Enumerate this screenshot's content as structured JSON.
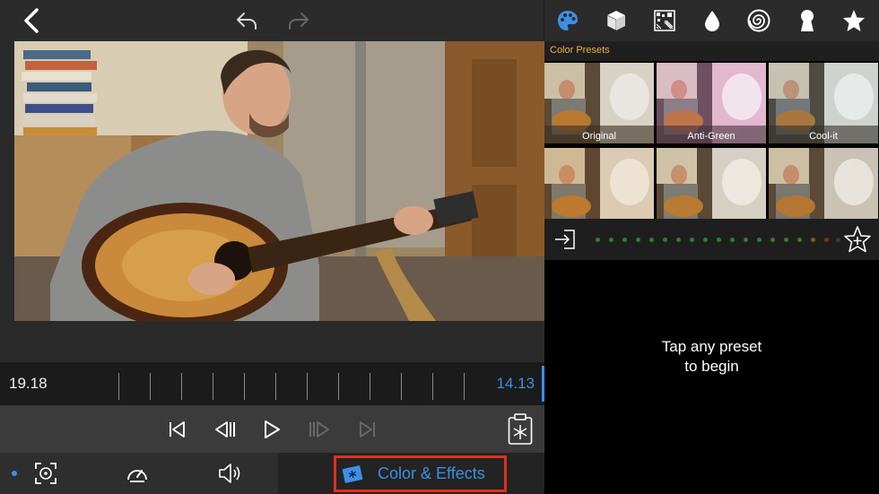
{
  "colors": {
    "accent": "#3d8fe6",
    "presets_title": "#e8b23c",
    "highlight_border": "#e0301e"
  },
  "top_bar": {
    "back_icon": "chevron-left-icon",
    "undo_icon": "undo-icon",
    "redo_icon": "redo-icon",
    "category_icons": [
      "palette-icon",
      "cube-icon",
      "pattern-icon",
      "drop-icon",
      "spiral-icon",
      "keyhole-icon",
      "star-icon"
    ]
  },
  "timeline": {
    "time_left": "19.18",
    "time_right": "14.13"
  },
  "transport": {
    "icons": [
      "skip-to-start-icon",
      "step-back-icon",
      "play-icon",
      "step-forward-icon",
      "skip-to-end-icon",
      "freeze-frame-icon"
    ]
  },
  "bottom_bar": {
    "icons": [
      "fit-frame-icon",
      "speed-icon",
      "volume-icon"
    ],
    "color_effects_label": "Color & Effects",
    "color_effects_icon": "color-effects-icon"
  },
  "right_panel": {
    "presets_title": "Color Presets",
    "presets": [
      {
        "label": "Original"
      },
      {
        "label": "Anti-Green"
      },
      {
        "label": "Cool-it"
      },
      {
        "label": ""
      },
      {
        "label": ""
      },
      {
        "label": ""
      }
    ],
    "import_icon": "import-icon",
    "add_favorite_icon": "star-plus-icon",
    "hint_line1": "Tap any preset",
    "hint_line2": "to begin"
  }
}
